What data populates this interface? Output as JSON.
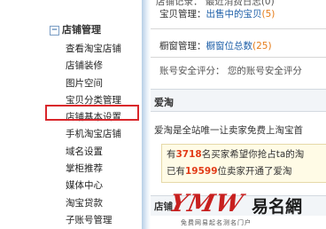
{
  "sidebar": {
    "header": "店铺管理",
    "header_toggle": "−",
    "items": [
      {
        "label": "查看淘宝店铺"
      },
      {
        "label": "店铺装修"
      },
      {
        "label": "图片空间"
      },
      {
        "label": "宝贝分类管理"
      },
      {
        "label": "店铺基本设置"
      },
      {
        "label": "手机淘宝店铺"
      },
      {
        "label": "域名设置"
      },
      {
        "label": "掌柜推荐"
      },
      {
        "label": "媒体中心"
      },
      {
        "label": "淘宝贷款"
      },
      {
        "label": "子账号管理"
      }
    ]
  },
  "main": {
    "top_row": "店铺记录：  最近消费日志(0)",
    "goods": {
      "label": "宝贝管理：",
      "link": "出售中的宝贝",
      "count": "(5)"
    },
    "showcase": {
      "label": "橱窗管理：",
      "link": "橱窗位总数",
      "count": "(25)"
    },
    "security": "账号安全评分：  您的账号安全评分",
    "aitao": {
      "title": "爱淘",
      "desc": "爱淘是全站唯一让卖家免费上淘宝首",
      "promo_pre1": "有",
      "promo_num1": "3718",
      "promo_post1": "名买家希望你抢占ta的淘",
      "promo_pre2": "已有",
      "promo_num2": "19599",
      "promo_post2": "位卖家开通了爱淘"
    },
    "next_section_title": "店铺"
  },
  "watermark": {
    "latin": "YMW",
    "cn": "易名網",
    "tagline": "免费网易起名测名门户"
  },
  "colors": {
    "highlight": "#d9262b",
    "link": "#1e5fa8",
    "count": "#e57b17",
    "number": "#e23b17"
  }
}
